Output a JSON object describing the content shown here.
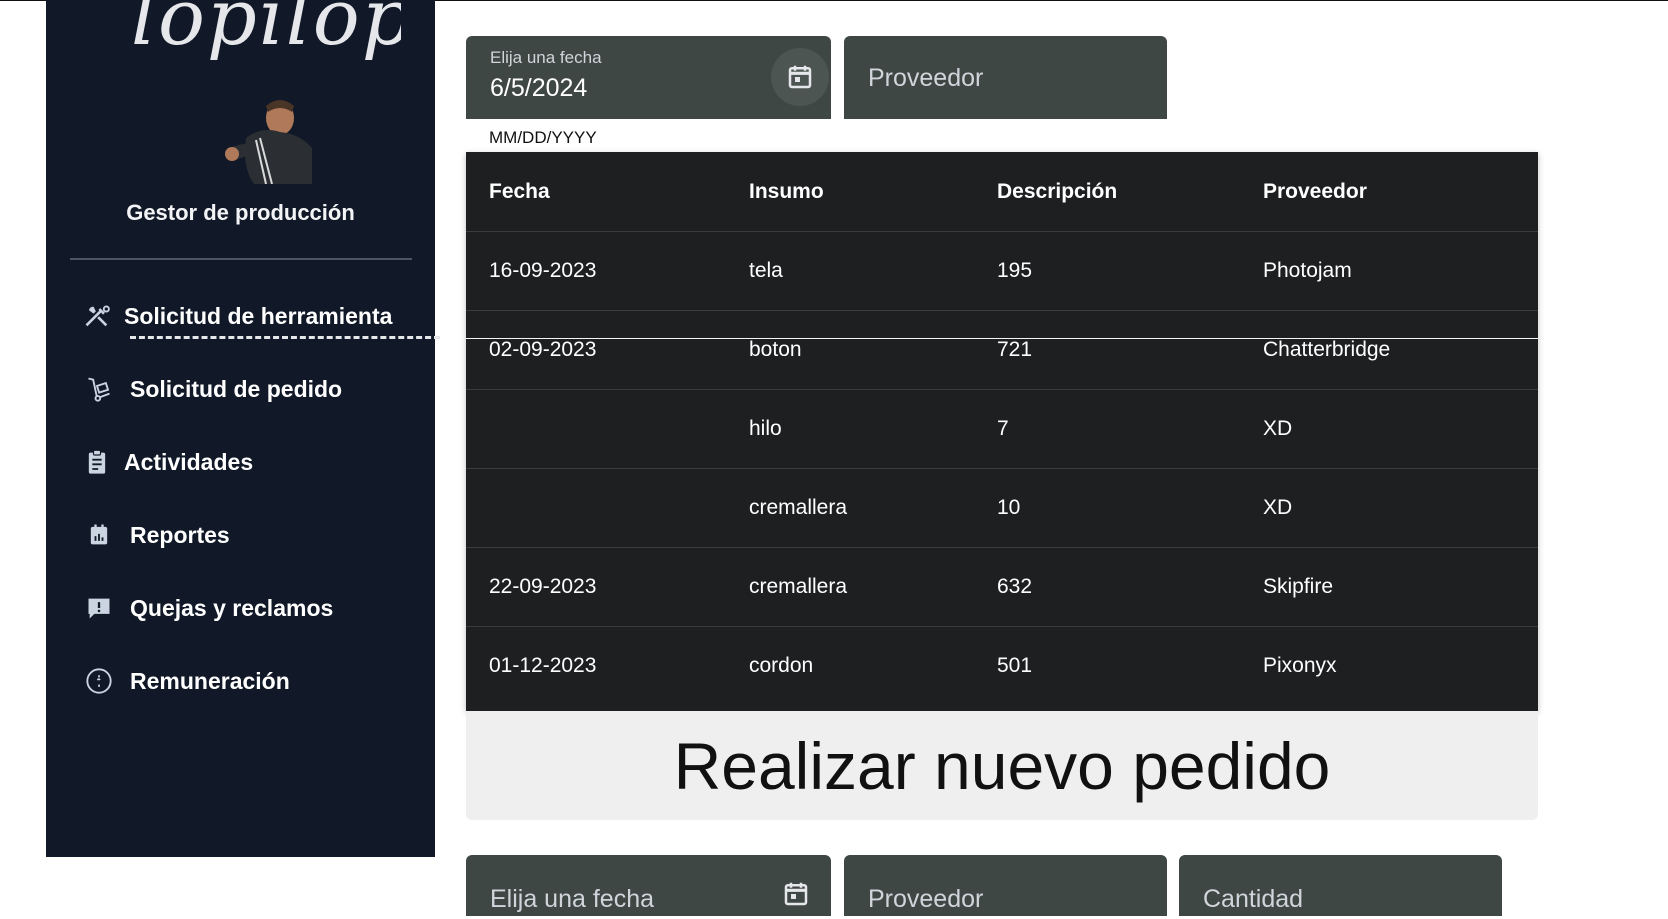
{
  "sidebar": {
    "logo_text": "lopilop",
    "title": "Gestor de producción",
    "items": [
      {
        "label": "Solicitud de herramienta",
        "icon": "tools-icon"
      },
      {
        "label": "Solicitud de pedido",
        "icon": "dolly-icon"
      },
      {
        "label": "Actividades",
        "icon": "clipboard-icon"
      },
      {
        "label": "Reportes",
        "icon": "calendar-report-icon"
      },
      {
        "label": "Quejas y reclamos",
        "icon": "feedback-icon"
      },
      {
        "label": "Remuneración",
        "icon": "dollar-circle-icon"
      }
    ]
  },
  "filters": {
    "date_label": "Elija una fecha",
    "date_value": "6/5/2024",
    "date_hint": "MM/DD/YYYY",
    "provider_placeholder": "Proveedor"
  },
  "table": {
    "headers": [
      "Fecha",
      "Insumo",
      "Descripción",
      "Proveedor"
    ],
    "rows": [
      [
        "16-09-2023",
        "tela",
        "195",
        "Photojam"
      ],
      [
        "02-09-2023",
        "boton",
        "721",
        "Chatterbridge"
      ],
      [
        "",
        "hilo",
        "7",
        "XD"
      ],
      [
        "",
        "cremallera",
        "10",
        "XD"
      ],
      [
        "22-09-2023",
        "cremallera",
        "632",
        "Skipfire"
      ],
      [
        "01-12-2023",
        "cordon",
        "501",
        "Pixonyx"
      ]
    ]
  },
  "new_order": {
    "title": "Realizar nuevo pedido",
    "date_placeholder": "Elija una fecha",
    "provider_placeholder": "Proveedor",
    "quantity_placeholder": "Cantidad"
  },
  "colors": {
    "sidebar_bg": "#111827",
    "field_bg": "#3f4744",
    "table_bg": "#1e1f21"
  }
}
